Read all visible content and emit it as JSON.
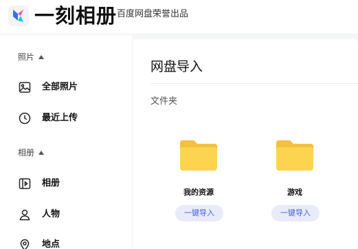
{
  "header": {
    "app_name": "一刻相册",
    "subtitle": "百度网盘荣誉出品",
    "logo_icon": "app-logo-icon"
  },
  "sidebar": {
    "sections": [
      {
        "title": "照片",
        "items": [
          {
            "label": "全部照片",
            "icon": "image-icon"
          },
          {
            "label": "最近上传",
            "icon": "clock-icon"
          }
        ]
      },
      {
        "title": "相册",
        "items": [
          {
            "label": "相册",
            "icon": "album-icon"
          },
          {
            "label": "人物",
            "icon": "person-icon"
          },
          {
            "label": "地点",
            "icon": "location-icon"
          }
        ]
      }
    ]
  },
  "main": {
    "title": "网盘导入",
    "section_label": "文件夹",
    "folders": [
      {
        "name": "我的资源",
        "button_label": "一键导入"
      },
      {
        "name": "游戏",
        "button_label": "一键导入"
      }
    ]
  },
  "colors": {
    "folder": "#fdd44f",
    "folder_tab": "#f2c13f",
    "button_bg": "#e8ebfa",
    "button_text": "#4960d9",
    "logo_blue": "#3d6bf5",
    "logo_pink": "#f24f9b",
    "logo_teal": "#1fc6d6"
  }
}
